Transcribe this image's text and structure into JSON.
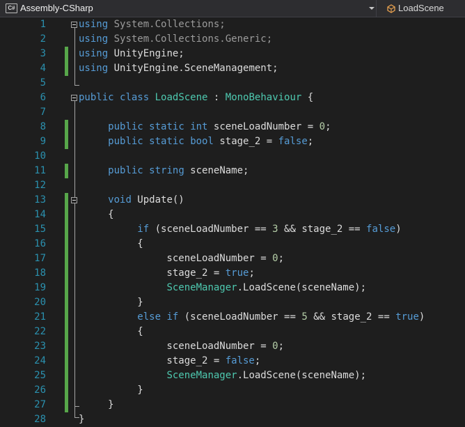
{
  "navbar": {
    "project_icon_text": "C#",
    "project_name": "Assembly-CSharp",
    "member_name": "LoadScene",
    "member_icon": "class-icon"
  },
  "editor": {
    "colors": {
      "keyword": "#569cd6",
      "type": "#4ec9b0",
      "text": "#dcdcdc",
      "number": "#b5cea8",
      "line_number": "#2b91af",
      "change_bar": "#57a64a"
    },
    "lines": [
      {
        "num": "1",
        "tokens": [
          [
            "k",
            "using"
          ],
          [
            "gray",
            " System.Collections;"
          ]
        ]
      },
      {
        "num": "2",
        "tokens": [
          [
            "k",
            "using"
          ],
          [
            "gray",
            " System.Collections.Generic;"
          ]
        ]
      },
      {
        "num": "3",
        "tokens": [
          [
            "k",
            "using"
          ],
          [
            "p",
            " UnityEngine;"
          ]
        ]
      },
      {
        "num": "4",
        "tokens": [
          [
            "k",
            "using"
          ],
          [
            "p",
            " UnityEngine.SceneManagement;"
          ]
        ]
      },
      {
        "num": "5",
        "tokens": []
      },
      {
        "num": "6",
        "tokens": [
          [
            "k",
            "public"
          ],
          [
            "p",
            " "
          ],
          [
            "k",
            "class"
          ],
          [
            "p",
            " "
          ],
          [
            "t",
            "LoadScene"
          ],
          [
            "p",
            " : "
          ],
          [
            "t",
            "MonoBehaviour"
          ],
          [
            "p",
            " {"
          ]
        ]
      },
      {
        "num": "7",
        "tokens": []
      },
      {
        "num": "8",
        "tokens": [
          [
            "p",
            "     "
          ],
          [
            "k",
            "public"
          ],
          [
            "p",
            " "
          ],
          [
            "k",
            "static"
          ],
          [
            "p",
            " "
          ],
          [
            "k",
            "int"
          ],
          [
            "p",
            " sceneLoadNumber = "
          ],
          [
            "n",
            "0"
          ],
          [
            "p",
            ";"
          ]
        ]
      },
      {
        "num": "9",
        "tokens": [
          [
            "p",
            "     "
          ],
          [
            "k",
            "public"
          ],
          [
            "p",
            " "
          ],
          [
            "k",
            "static"
          ],
          [
            "p",
            " "
          ],
          [
            "k",
            "bool"
          ],
          [
            "p",
            " stage_2 = "
          ],
          [
            "k",
            "false"
          ],
          [
            "p",
            ";"
          ]
        ]
      },
      {
        "num": "10",
        "tokens": []
      },
      {
        "num": "11",
        "tokens": [
          [
            "p",
            "     "
          ],
          [
            "k",
            "public"
          ],
          [
            "p",
            " "
          ],
          [
            "k",
            "string"
          ],
          [
            "p",
            " sceneName;"
          ]
        ]
      },
      {
        "num": "12",
        "tokens": []
      },
      {
        "num": "13",
        "tokens": [
          [
            "p",
            "     "
          ],
          [
            "k",
            "void"
          ],
          [
            "p",
            " Update()"
          ]
        ]
      },
      {
        "num": "14",
        "tokens": [
          [
            "p",
            "     {"
          ]
        ]
      },
      {
        "num": "15",
        "tokens": [
          [
            "p",
            "          "
          ],
          [
            "k",
            "if"
          ],
          [
            "p",
            " (sceneLoadNumber == "
          ],
          [
            "n",
            "3"
          ],
          [
            "p",
            " && stage_2 == "
          ],
          [
            "k",
            "false"
          ],
          [
            "p",
            ")"
          ]
        ]
      },
      {
        "num": "16",
        "tokens": [
          [
            "p",
            "          {"
          ]
        ]
      },
      {
        "num": "17",
        "tokens": [
          [
            "p",
            "               sceneLoadNumber = "
          ],
          [
            "n",
            "0"
          ],
          [
            "p",
            ";"
          ]
        ]
      },
      {
        "num": "18",
        "tokens": [
          [
            "p",
            "               stage_2 = "
          ],
          [
            "k",
            "true"
          ],
          [
            "p",
            ";"
          ]
        ]
      },
      {
        "num": "19",
        "tokens": [
          [
            "p",
            "               "
          ],
          [
            "t",
            "SceneManager"
          ],
          [
            "p",
            ".LoadScene(sceneName);"
          ]
        ]
      },
      {
        "num": "20",
        "tokens": [
          [
            "p",
            "          }"
          ]
        ]
      },
      {
        "num": "21",
        "tokens": [
          [
            "p",
            "          "
          ],
          [
            "k",
            "else"
          ],
          [
            "p",
            " "
          ],
          [
            "k",
            "if"
          ],
          [
            "p",
            " (sceneLoadNumber == "
          ],
          [
            "n",
            "5"
          ],
          [
            "p",
            " && stage_2 == "
          ],
          [
            "k",
            "true"
          ],
          [
            "p",
            ")"
          ]
        ]
      },
      {
        "num": "22",
        "tokens": [
          [
            "p",
            "          {"
          ]
        ]
      },
      {
        "num": "23",
        "tokens": [
          [
            "p",
            "               sceneLoadNumber = "
          ],
          [
            "n",
            "0"
          ],
          [
            "p",
            ";"
          ]
        ]
      },
      {
        "num": "24",
        "tokens": [
          [
            "p",
            "               stage_2 = "
          ],
          [
            "k",
            "false"
          ],
          [
            "p",
            ";"
          ]
        ]
      },
      {
        "num": "25",
        "tokens": [
          [
            "p",
            "               "
          ],
          [
            "t",
            "SceneManager"
          ],
          [
            "p",
            ".LoadScene(sceneName);"
          ]
        ]
      },
      {
        "num": "26",
        "tokens": [
          [
            "p",
            "          }"
          ]
        ]
      },
      {
        "num": "27",
        "tokens": [
          [
            "p",
            "     }"
          ]
        ]
      },
      {
        "num": "28",
        "tokens": [
          [
            "p",
            "}"
          ]
        ]
      }
    ],
    "changed_lines": [
      3,
      4,
      8,
      9,
      11,
      13,
      14,
      15,
      16,
      17,
      18,
      19,
      20,
      21,
      22,
      23,
      24,
      25,
      26,
      27
    ],
    "fold_lines": [
      1,
      6,
      13
    ]
  }
}
